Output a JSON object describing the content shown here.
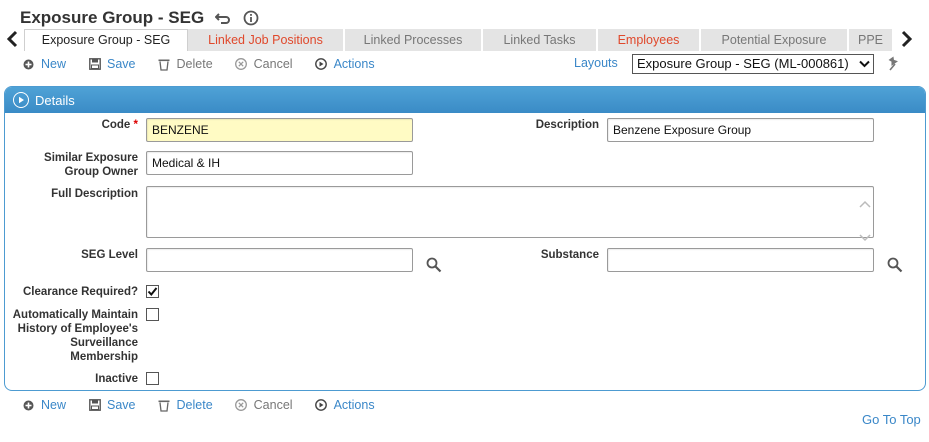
{
  "header": {
    "title": "Exposure Group - SEG",
    "undo_icon": "undo-icon",
    "info_icon": "info-icon"
  },
  "tabs": [
    {
      "label": "Exposure Group - SEG",
      "active": true
    },
    {
      "label": "Linked Job Positions",
      "highlight": true
    },
    {
      "label": "Linked Processes"
    },
    {
      "label": "Linked Tasks"
    },
    {
      "label": "Employees",
      "highlight": true
    },
    {
      "label": "Potential Exposure"
    },
    {
      "label": "PPE"
    }
  ],
  "toolbar": {
    "new_label": "New",
    "save_label": "Save",
    "delete_label": "Delete",
    "cancel_label": "Cancel",
    "actions_label": "Actions"
  },
  "layouts": {
    "label": "Layouts",
    "selected": "Exposure Group - SEG (ML-000861)"
  },
  "panel": {
    "title": "Details"
  },
  "form": {
    "code_label": "Code",
    "code_value": "BENZENE",
    "description_label": "Description",
    "description_value": "Benzene Exposure Group",
    "owner_label_1": "Similar Exposure",
    "owner_label_2": "Group Owner",
    "owner_value": "Medical & IH",
    "full_description_label": "Full Description",
    "full_description_value": "",
    "seg_level_label": "SEG Level",
    "seg_level_value": "",
    "substance_label": "Substance",
    "substance_value": "",
    "clearance_label": "Clearance Required?",
    "clearance_checked": true,
    "auto_label_1": "Automatically Maintain",
    "auto_label_2": "History of Employee's",
    "auto_label_3": "Surveillance",
    "auto_label_4": "Membership",
    "auto_checked": false,
    "inactive_label": "Inactive",
    "inactive_checked": false
  },
  "footer": {
    "goto_top": "Go To Top"
  },
  "colors": {
    "accent": "#3a87c8",
    "panel_header": "#4fa2d6",
    "highlight_tab": "#e0482b",
    "required_field": "#fffbc4"
  }
}
